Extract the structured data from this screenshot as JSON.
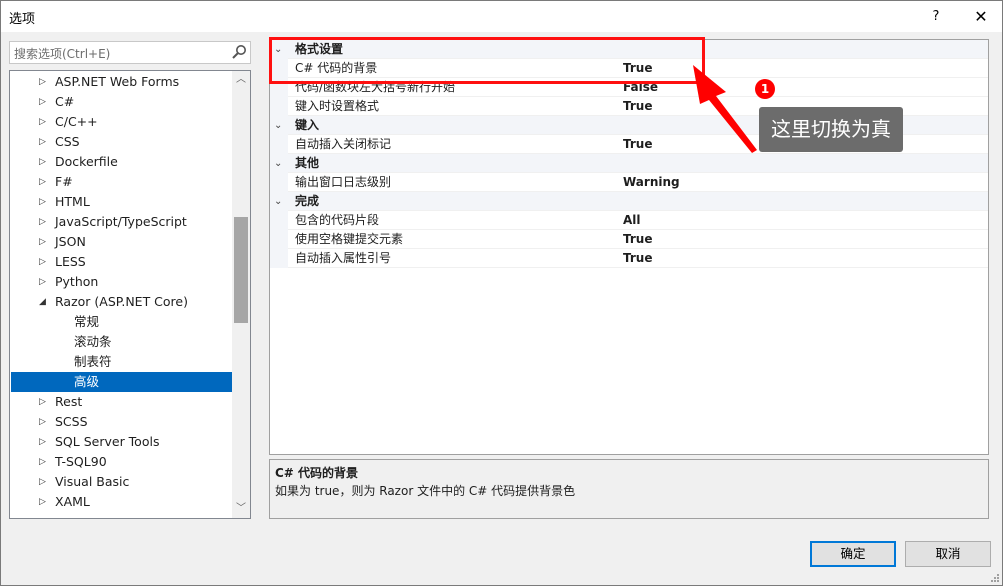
{
  "window": {
    "title": "选项",
    "help_label": "?",
    "close_label": "✕"
  },
  "search": {
    "placeholder": "搜索选项(Ctrl+E)"
  },
  "tree": {
    "items": [
      {
        "label": "ASP.NET Web Forms",
        "expanded": false
      },
      {
        "label": "C#",
        "expanded": false
      },
      {
        "label": "C/C++",
        "expanded": false
      },
      {
        "label": "CSS",
        "expanded": false
      },
      {
        "label": "Dockerfile",
        "expanded": false
      },
      {
        "label": "F#",
        "expanded": false
      },
      {
        "label": "HTML",
        "expanded": false
      },
      {
        "label": "JavaScript/TypeScript",
        "expanded": false
      },
      {
        "label": "JSON",
        "expanded": false
      },
      {
        "label": "LESS",
        "expanded": false
      },
      {
        "label": "Python",
        "expanded": false
      },
      {
        "label": "Razor (ASP.NET Core)",
        "expanded": true
      },
      {
        "label": "常规",
        "child": true
      },
      {
        "label": "滚动条",
        "child": true
      },
      {
        "label": "制表符",
        "child": true
      },
      {
        "label": "高级",
        "child": true,
        "selected": true
      },
      {
        "label": "Rest",
        "expanded": false
      },
      {
        "label": "SCSS",
        "expanded": false
      },
      {
        "label": "SQL Server Tools",
        "expanded": false
      },
      {
        "label": "T-SQL90",
        "expanded": false
      },
      {
        "label": "Visual Basic",
        "expanded": false
      },
      {
        "label": "XAML",
        "expanded": false
      }
    ],
    "collapsed_arrow": "▷",
    "expanded_arrow": "◢",
    "scroll_up": "︿",
    "scroll_down": "﹀"
  },
  "grid": {
    "chevron": "⌄",
    "rows": [
      {
        "type": "cat",
        "name": "格式设置"
      },
      {
        "type": "prop",
        "name": "C# 代码的背景",
        "value": "True"
      },
      {
        "type": "prop",
        "name": "代码/函数块左大括号新行开始",
        "value": "False"
      },
      {
        "type": "prop",
        "name": "键入时设置格式",
        "value": "True"
      },
      {
        "type": "cat",
        "name": "键入"
      },
      {
        "type": "prop",
        "name": "自动插入关闭标记",
        "value": "True"
      },
      {
        "type": "cat",
        "name": "其他"
      },
      {
        "type": "prop",
        "name": "输出窗口日志级别",
        "value": "Warning"
      },
      {
        "type": "cat",
        "name": "完成"
      },
      {
        "type": "prop",
        "name": "包含的代码片段",
        "value": "All"
      },
      {
        "type": "prop",
        "name": "使用空格键提交元素",
        "value": "True"
      },
      {
        "type": "prop",
        "name": "自动插入属性引号",
        "value": "True"
      }
    ]
  },
  "description": {
    "title": "C# 代码的背景",
    "text": "如果为 true，则为 Razor 文件中的 C# 代码提供背景色"
  },
  "buttons": {
    "ok": "确定",
    "cancel": "取消"
  },
  "annotation": {
    "badge": "1",
    "tooltip": "这里切换为真",
    "color": "#ff0000"
  }
}
